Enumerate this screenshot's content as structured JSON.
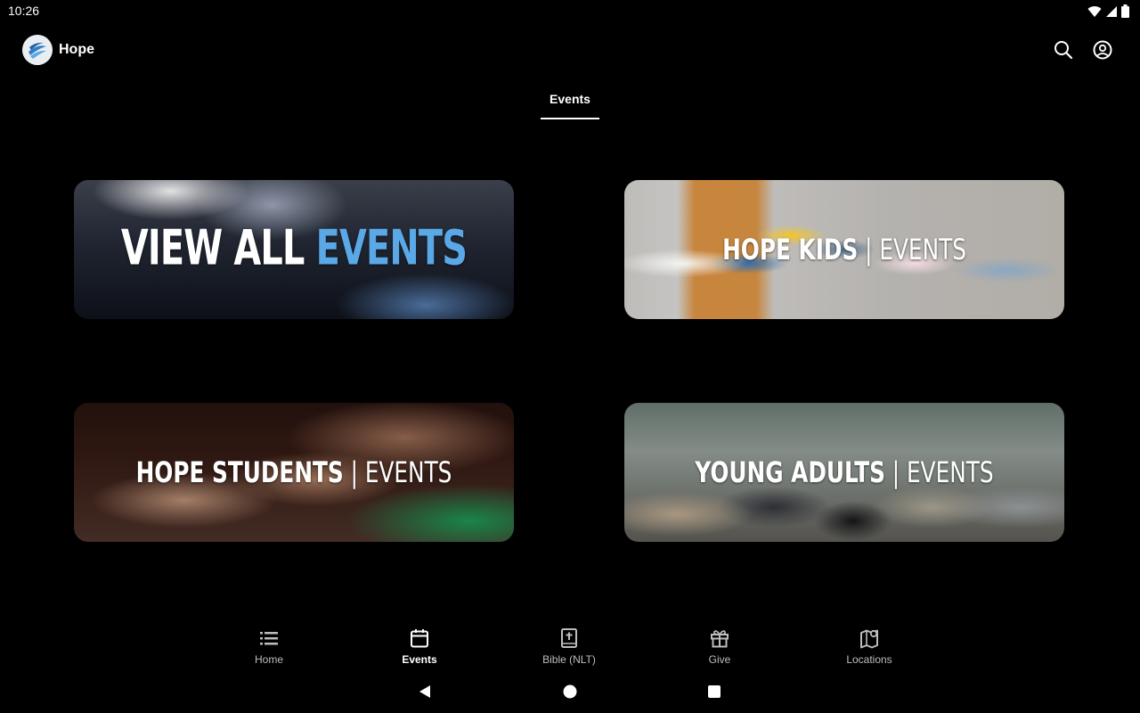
{
  "status_bar": {
    "time": "10:26",
    "icons": [
      "wifi-icon",
      "signal-icon",
      "battery-icon"
    ]
  },
  "app_bar": {
    "title": "Hope",
    "actions": [
      "search-icon",
      "account-icon"
    ]
  },
  "tabs": [
    {
      "label": "Events",
      "selected": true
    }
  ],
  "cards": [
    {
      "id": "view-all-events",
      "text_bold": "VIEW ALL ",
      "text_accent": "EVENTS",
      "accent_color": "#5aa9e6"
    },
    {
      "id": "hope-kids",
      "text_bold": "HOPE KIDS",
      "separator": " | ",
      "text_light": "EVENTS"
    },
    {
      "id": "hope-students",
      "text_bold": "HOPE STUDENTS",
      "separator": " | ",
      "text_light": "EVENTS"
    },
    {
      "id": "young-adults",
      "text_bold": "YOUNG ADULTS",
      "separator": " | ",
      "text_light": "EVENTS"
    }
  ],
  "bottom_nav": [
    {
      "label": "Home",
      "icon": "list-icon",
      "active": false
    },
    {
      "label": "Events",
      "icon": "calendar-icon",
      "active": true
    },
    {
      "label": "Bible (NLT)",
      "icon": "bible-icon",
      "active": false
    },
    {
      "label": "Give",
      "icon": "gift-icon",
      "active": false
    },
    {
      "label": "Locations",
      "icon": "map-pin-icon",
      "active": false
    }
  ],
  "system_nav": [
    "back-icon",
    "home-circle-icon",
    "recents-icon"
  ]
}
